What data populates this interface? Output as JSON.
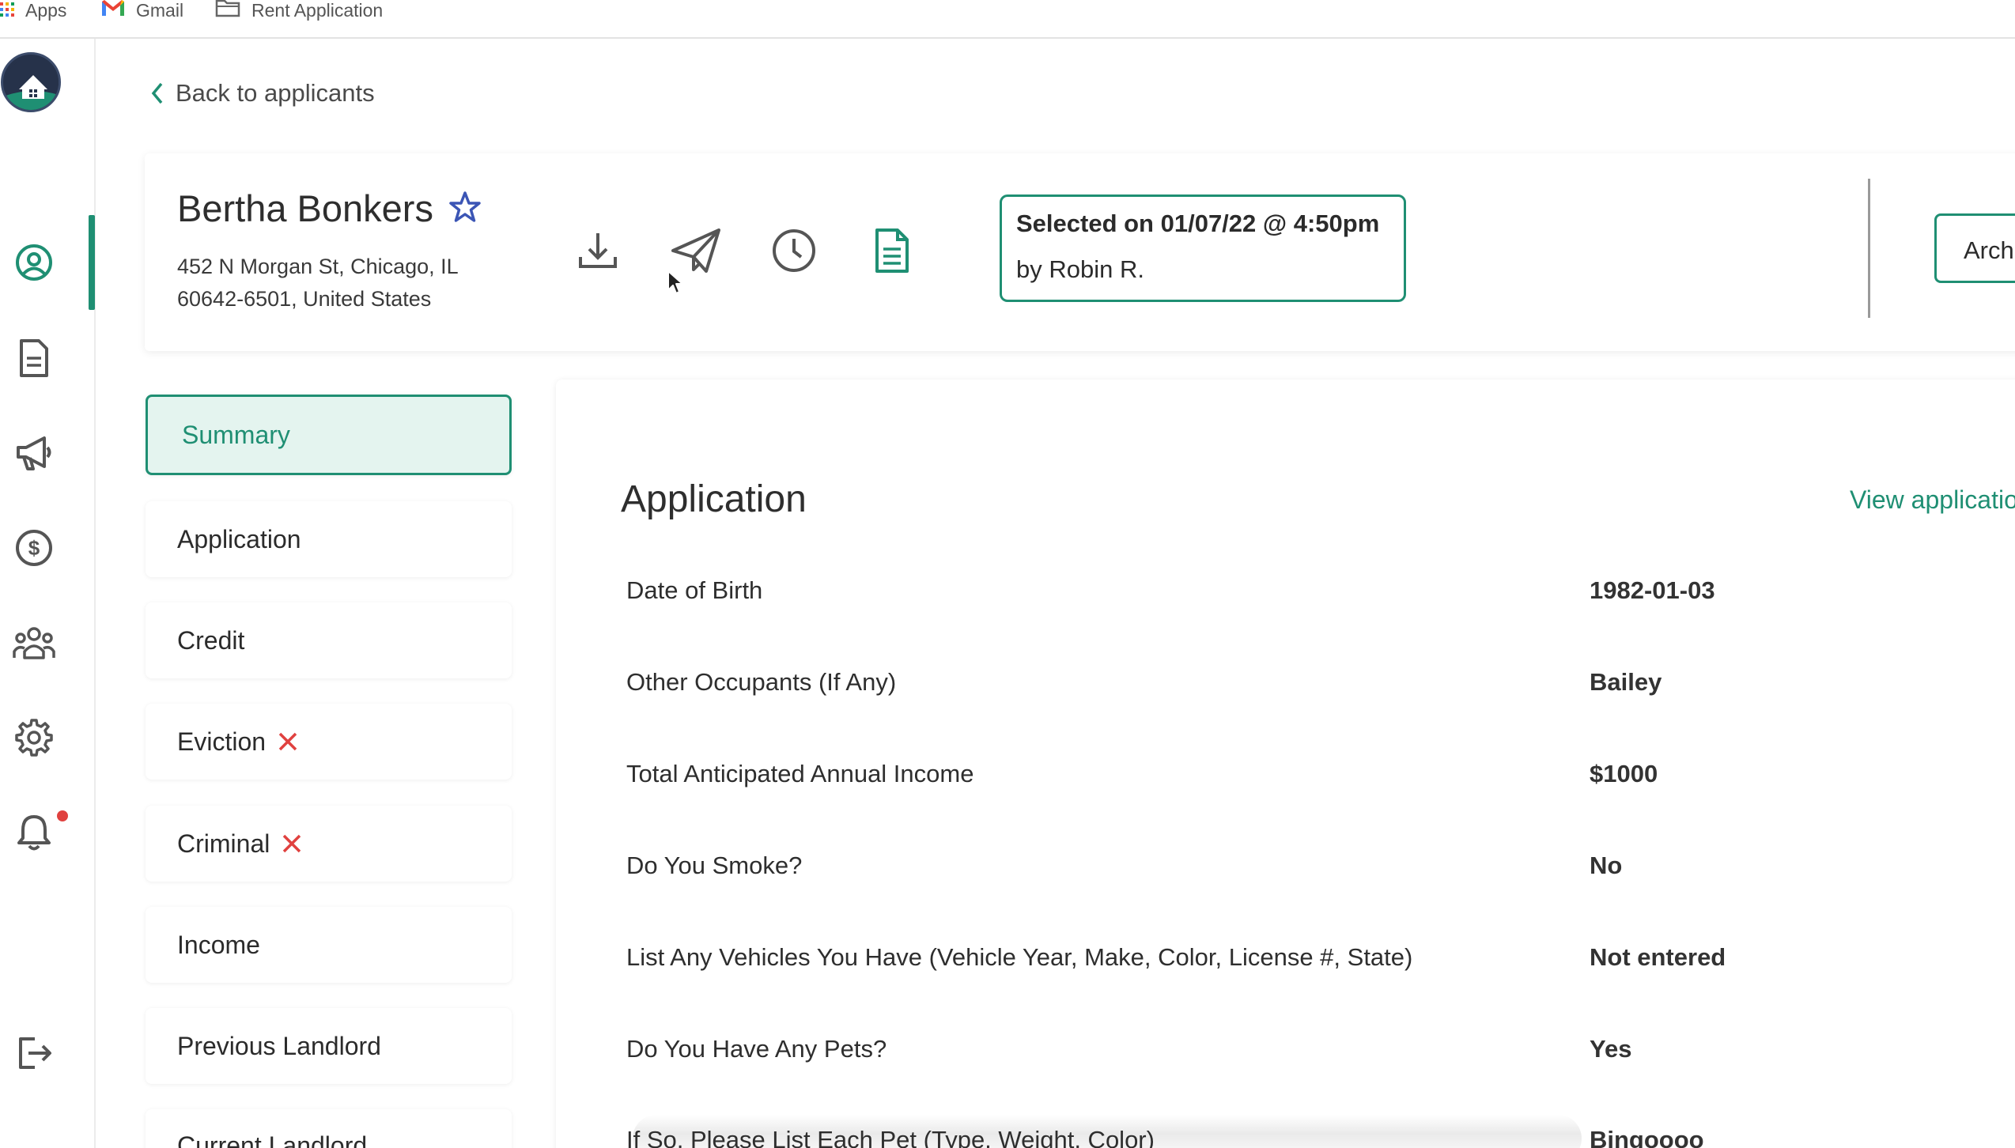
{
  "bookmarks": {
    "items": [
      {
        "label": "Apps",
        "icon": "apps-grid-icon"
      },
      {
        "label": "Gmail",
        "icon": "gmail-icon"
      },
      {
        "label": "Rent Application",
        "icon": "folder-icon"
      }
    ]
  },
  "sidebar": {
    "items": [
      {
        "name": "profile",
        "icon": "user-circle-icon"
      },
      {
        "name": "documents",
        "icon": "document-icon"
      },
      {
        "name": "marketing",
        "icon": "megaphone-icon"
      },
      {
        "name": "payments",
        "icon": "dollar-circle-icon"
      },
      {
        "name": "tenants",
        "icon": "people-group-icon"
      },
      {
        "name": "settings",
        "icon": "gear-icon"
      },
      {
        "name": "notifications",
        "icon": "bell-icon",
        "has_badge": true
      },
      {
        "name": "logout",
        "icon": "logout-icon"
      }
    ],
    "active": "profile",
    "accent": "#1f8f73"
  },
  "back_link": "Back to applicants",
  "applicant": {
    "name": "Bertha Bonkers",
    "address_line1": "452 N Morgan St, Chicago, IL",
    "address_line2": "60642-6501, United States",
    "actions": [
      "download-icon",
      "send-icon",
      "history-clock-icon",
      "file-text-icon"
    ],
    "selected_line": "Selected on 01/07/22 @ 4:50pm",
    "selected_by": "by Robin R.",
    "archive_label": "Arch"
  },
  "sections": [
    {
      "label": "Summary",
      "active": true,
      "flag": false
    },
    {
      "label": "Application",
      "active": false,
      "flag": false
    },
    {
      "label": "Credit",
      "active": false,
      "flag": false
    },
    {
      "label": "Eviction",
      "active": false,
      "flag": true
    },
    {
      "label": "Criminal",
      "active": false,
      "flag": true
    },
    {
      "label": "Income",
      "active": false,
      "flag": false
    },
    {
      "label": "Previous Landlord",
      "active": false,
      "flag": false
    },
    {
      "label": "Current Landlord",
      "active": false,
      "flag": false
    }
  ],
  "application": {
    "title": "Application",
    "view_link": "View applicatio",
    "rows": [
      {
        "label": "Date of Birth",
        "value": "1982-01-03"
      },
      {
        "label": "Other Occupants (If Any)",
        "value": "Bailey"
      },
      {
        "label": "Total Anticipated Annual Income",
        "value": "$1000"
      },
      {
        "label": "Do You Smoke?",
        "value": "No"
      },
      {
        "label": "List Any Vehicles You Have (Vehicle Year, Make, Color, License #, State)",
        "value": "Not entered"
      },
      {
        "label": "Do You Have Any Pets?",
        "value": "Yes"
      },
      {
        "label": "If So, Please List Each Pet (Type, Weight, Color)",
        "value": "Bingoooo"
      }
    ]
  },
  "colors": {
    "accent": "#1f8f73",
    "danger": "#e0413f",
    "star": "#3b55b5"
  }
}
